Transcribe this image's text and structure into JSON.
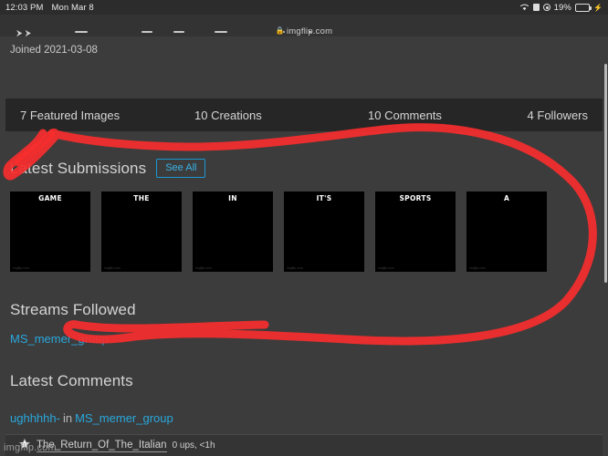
{
  "status_bar": {
    "time": "12:03 PM",
    "date": "Mon Mar 8",
    "wifi_icon": "wifi-icon",
    "alarm_icon": "alarm-icon",
    "dnd_icon": "do-not-disturb-icon",
    "battery_percent": "19%",
    "battery_icon": "battery-charging-icon",
    "charging_glyph": "⚡"
  },
  "browser": {
    "url": "imgflip.com",
    "lock_icon": "lock-icon",
    "back_forward_icon": "back-forward-arrows-icon"
  },
  "profile": {
    "joined_label": "Joined 2021-03-08"
  },
  "stats": [
    {
      "label": "7 Featured Images"
    },
    {
      "label": "10 Creations"
    },
    {
      "label": "10 Comments"
    },
    {
      "label": "4 Followers"
    }
  ],
  "submissions": {
    "title": "Latest Submissions",
    "see_all_label": "See All",
    "thumbnails": [
      {
        "caption": "GAME",
        "watermark": "imgflip.com"
      },
      {
        "caption": "THE",
        "watermark": "imgflip.com"
      },
      {
        "caption": "IN",
        "watermark": "imgflip.com"
      },
      {
        "caption": "IT'S",
        "watermark": "imgflip.com"
      },
      {
        "caption": "SPORTS",
        "watermark": "imgflip.com"
      },
      {
        "caption": "A",
        "watermark": "imgflip.com"
      }
    ]
  },
  "streams": {
    "title": "Streams Followed",
    "items": [
      {
        "name": "MS_memer_group"
      }
    ]
  },
  "comments": {
    "title": "Latest Comments",
    "items": [
      {
        "user": "ughhhhh-",
        "preposition": "in",
        "stream": "MS_memer_group"
      }
    ]
  },
  "bottom_bar": {
    "star_icon": "star-icon",
    "username": "The_Return_Of_The_Italian",
    "meta": "0 ups, <1h",
    "watermark": "imgflip.com"
  },
  "annotation": {
    "color": "#f52d2d",
    "shape": "hand-drawn-red-circle"
  },
  "colors": {
    "accent_link": "#29a8dd",
    "see_all_border": "#1b97d4",
    "page_bg": "#3c3c3c",
    "stats_bg": "#262626",
    "battery_green": "#2fd157"
  }
}
